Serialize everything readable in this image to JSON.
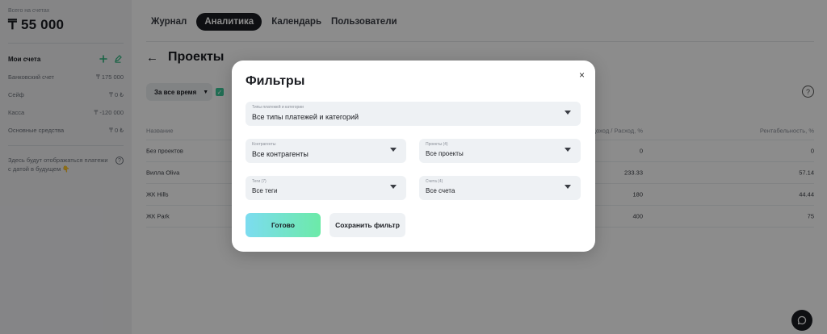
{
  "sidebar": {
    "balance_label": "Всего на счетах",
    "balance_value": "₸ 55 000",
    "accounts_title": "Мои счета",
    "accounts": [
      {
        "name": "Банковский счет",
        "amount": "₸ 175 000"
      },
      {
        "name": "Сейф",
        "amount": "₸ 0 ₺"
      },
      {
        "name": "Касса",
        "amount": "₸ -120 000"
      },
      {
        "name": "Основные средства",
        "amount": "₸ 0 ₺"
      }
    ],
    "future_note": "Здесь будут отображаться платежи с датой в будущем 👇"
  },
  "tabs": [
    {
      "label": "Журнал"
    },
    {
      "label": "Аналитика"
    },
    {
      "label": "Календарь"
    },
    {
      "label": "Пользователи"
    }
  ],
  "page": {
    "title": "Проекты",
    "period_label": "За все время"
  },
  "table": {
    "headers": {
      "name": "Название",
      "income_expense": "Доход / Расход, %",
      "profitability": "Рентабельность, %"
    },
    "rows": [
      {
        "name": "Без проектов",
        "income_expense": "0",
        "profitability": "0"
      },
      {
        "name": "Вилла Oliva",
        "income_expense": "233.33",
        "profitability": "57.14"
      },
      {
        "name": "ЖК Hills",
        "income_expense": "180",
        "profitability": "44.44"
      },
      {
        "name": "ЖК Park",
        "income_expense": "400",
        "profitability": "75"
      }
    ]
  },
  "modal": {
    "title": "Фильтры",
    "close": "×",
    "fields": {
      "types": {
        "label": "Типы платежей и категории",
        "value": "Все типы платежей и категорий"
      },
      "counterparties": {
        "label": "Контрагенты",
        "value": "Все контрагенты"
      },
      "projects": {
        "label": "Проекты (4)",
        "value": "Все проекты"
      },
      "tags": {
        "label": "Теги (7)",
        "value": "Все теги"
      },
      "accounts": {
        "label": "Счета (4)",
        "value": "Все счета"
      }
    },
    "done_label": "Готово",
    "save_label": "Сохранить фильтр"
  },
  "colors": {
    "accent": "#3cc99a",
    "dark": "#1b1d22"
  }
}
